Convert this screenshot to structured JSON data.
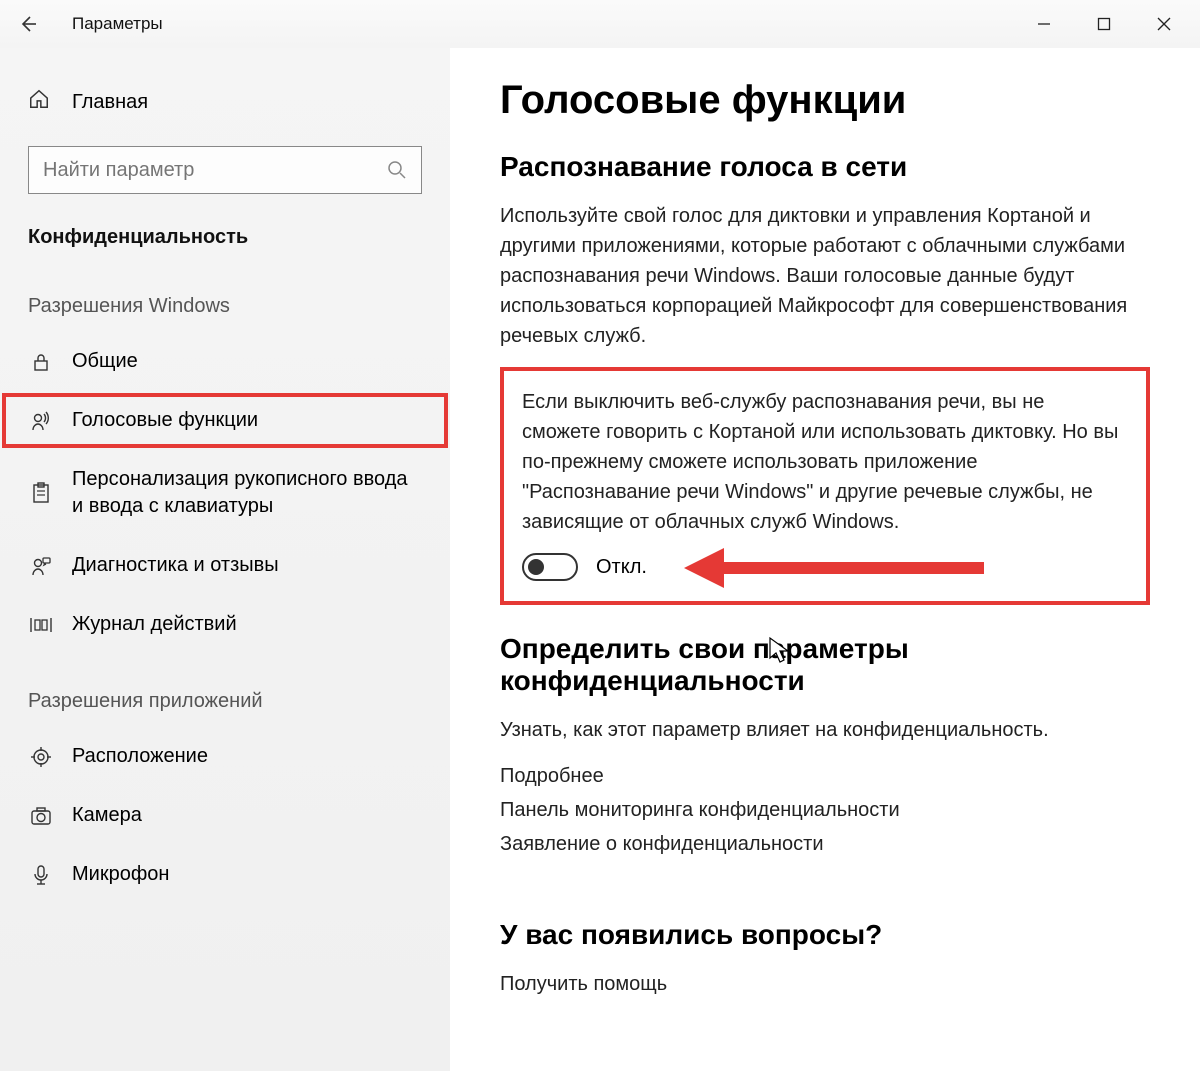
{
  "titlebar": {
    "title": "Параметры"
  },
  "sidebar": {
    "home": "Главная",
    "search_placeholder": "Найти параметр",
    "category": "Конфиденциальность",
    "section_windows": "Разрешения Windows",
    "items_windows": [
      {
        "label": "Общие"
      },
      {
        "label": "Голосовые функции"
      },
      {
        "label": "Персонализация рукописного ввода и ввода с клавиатуры"
      },
      {
        "label": "Диагностика и отзывы"
      },
      {
        "label": "Журнал действий"
      }
    ],
    "section_apps": "Разрешения приложений",
    "items_apps": [
      {
        "label": "Расположение"
      },
      {
        "label": "Камера"
      },
      {
        "label": "Микрофон"
      }
    ]
  },
  "main": {
    "title": "Голосовые функции",
    "h2_1": "Распознавание голоса в сети",
    "p1": "Используйте свой голос для диктовки и управления Кортаной и другими приложениями, которые работают с облачными службами распознавания речи Windows. Ваши голосовые данные будут использоваться корпорацией Майкрософт для совершенствования речевых служб.",
    "p2": "Если выключить веб-службу распознавания речи, вы не сможете говорить с Кортаной или использовать диктовку. Но вы по-прежнему сможете использовать приложение \"Распознавание речи Windows\" и другие речевые службы, не зависящие от облачных служб Windows.",
    "toggle_label": "Откл.",
    "h2_2": "Определить свои параметры конфиденциальности",
    "p3": "Узнать, как этот параметр влияет на конфиденциальность.",
    "links": [
      "Подробнее",
      "Панель мониторинга конфиденциальности",
      "Заявление о конфиденциальности"
    ],
    "h2_3": "У вас появились вопросы?",
    "help_link": "Получить помощь"
  }
}
